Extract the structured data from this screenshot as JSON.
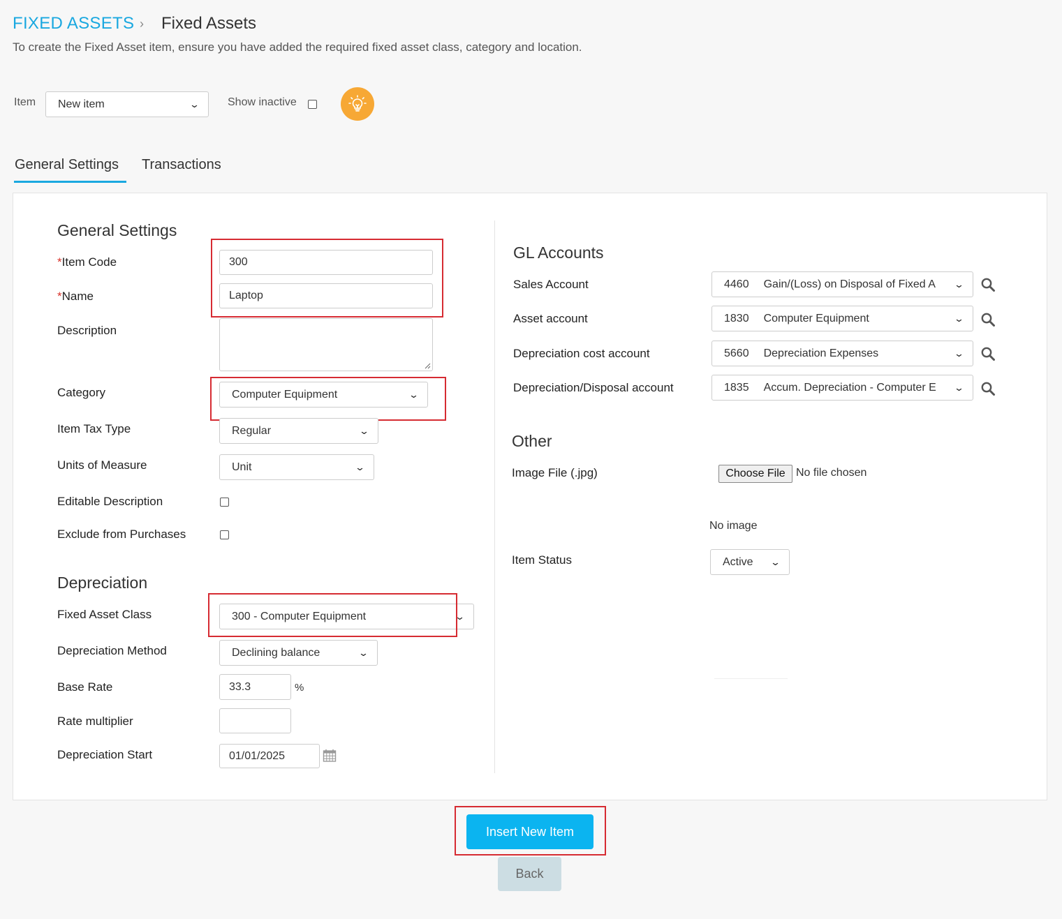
{
  "breadcrumb": {
    "root": "FIXED ASSETS",
    "separator": "›",
    "current": "Fixed Assets"
  },
  "subtitle": "To create the Fixed Asset item, ensure you have added the required fixed asset class, category and location.",
  "toolbar": {
    "item_label": "Item",
    "item_value": "New item",
    "show_inactive_label": "Show inactive",
    "show_inactive_checked": false,
    "help_icon": "lightbulb-icon"
  },
  "tabs": [
    {
      "label": "General Settings",
      "active": true
    },
    {
      "label": "Transactions",
      "active": false
    }
  ],
  "general": {
    "title": "General Settings",
    "item_code": {
      "label": "Item Code",
      "required_mark": "*",
      "value": "300"
    },
    "name": {
      "label": "Name",
      "required_mark": "*",
      "value": "Laptop"
    },
    "description": {
      "label": "Description",
      "value": ""
    },
    "category": {
      "label": "Category",
      "value": "Computer Equipment"
    },
    "item_tax_type": {
      "label": "Item Tax Type",
      "value": "Regular"
    },
    "units": {
      "label": "Units of Measure",
      "value": "Unit"
    },
    "editable_description": {
      "label": "Editable Description",
      "checked": false
    },
    "exclude_purchases": {
      "label": "Exclude from Purchases",
      "checked": false
    }
  },
  "depreciation": {
    "title": "Depreciation",
    "fixed_asset_class": {
      "label": "Fixed Asset Class",
      "value": "300 - Computer Equipment"
    },
    "method": {
      "label": "Depreciation Method",
      "value": "Declining balance"
    },
    "base_rate": {
      "label": "Base Rate",
      "value": "33.3",
      "unit": "%"
    },
    "rate_multiplier": {
      "label": "Rate multiplier",
      "value": ""
    },
    "start": {
      "label": "Depreciation Start",
      "value": "01/01/2025"
    }
  },
  "gl": {
    "title": "GL Accounts",
    "accounts": [
      {
        "label": "Sales Account",
        "code": "4460",
        "name": "Gain/(Loss) on Disposal of Fixed A"
      },
      {
        "label": "Asset account",
        "code": "1830",
        "name": "Computer Equipment"
      },
      {
        "label": "Depreciation cost account",
        "code": "5660",
        "name": "Depreciation Expenses"
      },
      {
        "label": "Depreciation/Disposal account",
        "code": "1835",
        "name": "Accum. Depreciation - Computer E"
      }
    ]
  },
  "other": {
    "title": "Other",
    "image_label": "Image File (.jpg)",
    "choose_file": "Choose File",
    "no_file": "No file chosen",
    "no_image": "No image",
    "status_label": "Item Status",
    "status_value": "Active"
  },
  "actions": {
    "insert": "Insert New Item",
    "back": "Back"
  },
  "colors": {
    "accent": "#1aa8e0",
    "primary_button": "#0bb4f0",
    "highlight_box": "#d62b32",
    "help_icon_bg": "#f7a835"
  }
}
